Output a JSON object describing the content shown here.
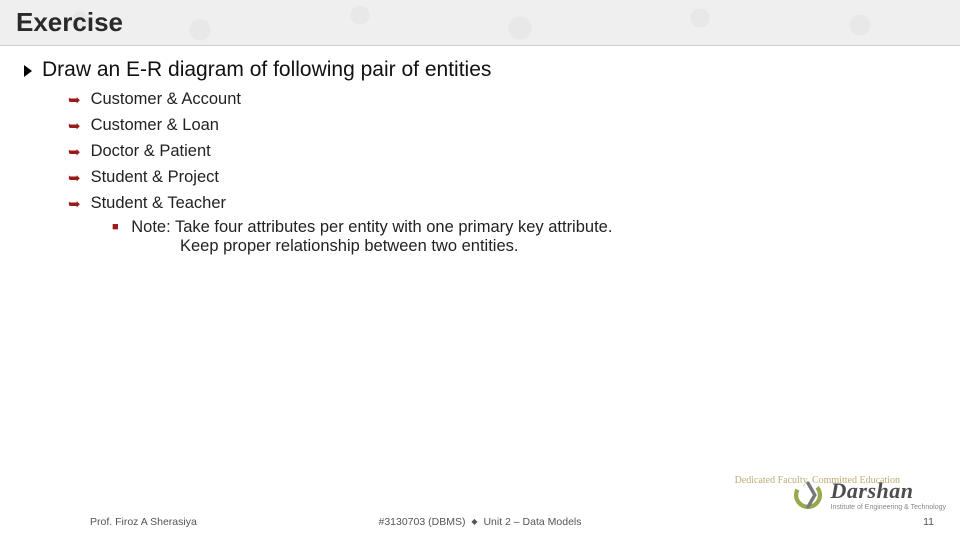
{
  "title": "Exercise",
  "main_bullet": "Draw an E-R diagram of following pair of entities",
  "items": [
    "Customer & Account",
    "Customer & Loan",
    "Doctor & Patient",
    "Student & Project",
    "Student & Teacher"
  ],
  "note": {
    "line1": "Note: Take four attributes per entity with one primary key attribute.",
    "line2": "Keep proper relationship between two entities."
  },
  "footer": {
    "professor": "Prof. Firoz A Sherasiya",
    "course_code": "#3130703 (DBMS)",
    "unit": "Unit 2 – Data Models",
    "page": "11"
  },
  "logo": {
    "name": "Darshan",
    "tagline": "Institute of Engineering & Technology",
    "overline": "Dedicated Faculty, Committed Education"
  }
}
